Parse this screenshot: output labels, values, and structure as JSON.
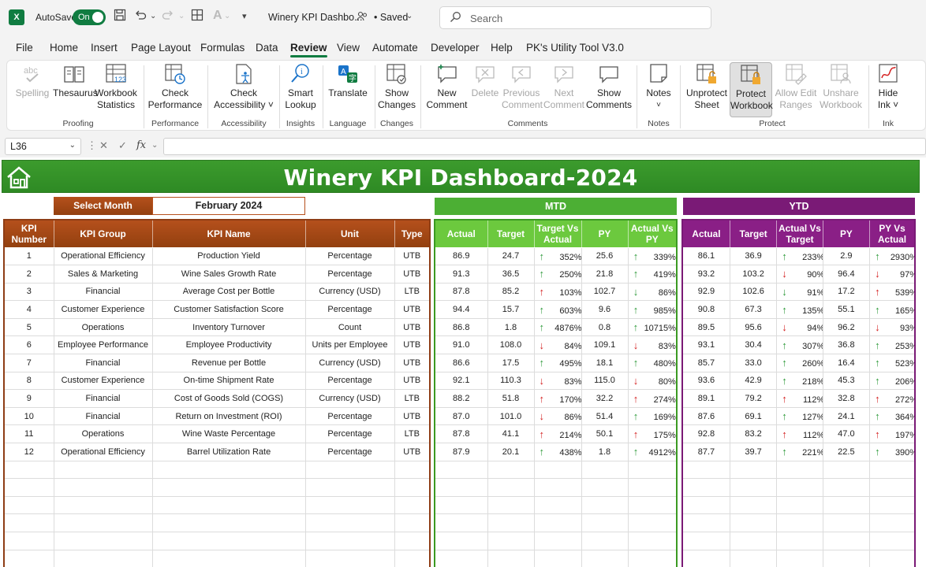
{
  "titlebar": {
    "app_badge": "X",
    "autosave_label": "AutoSave",
    "autosave_state": "On",
    "doc_title": "Winery KPI Dashbo...",
    "saved_status": "• Saved",
    "search_placeholder": "Search"
  },
  "menu": [
    "File",
    "Home",
    "Insert",
    "Page Layout",
    "Formulas",
    "Data",
    "Review",
    "View",
    "Automate",
    "Developer",
    "Help",
    "PK's Utility Tool V3.0"
  ],
  "menu_active": "Review",
  "ribbon": {
    "spelling": "Spelling",
    "thesaurus": "Thesaurus",
    "workbook_statistics_1": "Workbook",
    "workbook_statistics_2": "Statistics",
    "check_performance_1": "Check",
    "check_performance_2": "Performance",
    "check_accessibility_1": "Check",
    "check_accessibility_2": "Accessibility ˅",
    "smart_lookup_1": "Smart",
    "smart_lookup_2": "Lookup",
    "translate": "Translate",
    "show_changes_1": "Show",
    "show_changes_2": "Changes",
    "new_comment_1": "New",
    "new_comment_2": "Comment",
    "delete": "Delete",
    "previous_comment_1": "Previous",
    "previous_comment_2": "Comment",
    "next_comment_1": "Next",
    "next_comment_2": "Comment",
    "show_comments_1": "Show",
    "show_comments_2": "Comments",
    "notes": "Notes",
    "notes_caret": "˅",
    "unprotect_sheet_1": "Unprotect",
    "unprotect_sheet_2": "Sheet",
    "protect_workbook_1": "Protect",
    "protect_workbook_2": "Workbook",
    "allow_edit_ranges_1": "Allow Edit",
    "allow_edit_ranges_2": "Ranges",
    "unshare_workbook_1": "Unshare",
    "unshare_workbook_2": "Workbook",
    "hide_ink_1": "Hide",
    "hide_ink_2": "Ink ˅",
    "groups": {
      "proofing": "Proofing",
      "performance": "Performance",
      "accessibility": "Accessibility",
      "insights": "Insights",
      "language": "Language",
      "changes": "Changes",
      "comments": "Comments",
      "notes": "Notes",
      "protect": "Protect",
      "ink": "Ink"
    }
  },
  "formula_bar": {
    "name_box": "L36",
    "fx": "fx",
    "formula": ""
  },
  "dashboard": {
    "title": "Winery KPI Dashboard-2024",
    "select_month_label": "Select Month",
    "selected_month": "February 2024",
    "mtd_label": "MTD",
    "ytd_label": "YTD",
    "kpi_headers": [
      "KPI Number",
      "KPI Group",
      "KPI Name",
      "Unit",
      "Type"
    ],
    "mtd_headers": [
      "Actual",
      "Target",
      "Target Vs Actual",
      "PY",
      "Actual Vs PY"
    ],
    "ytd_headers": [
      "Actual",
      "Target",
      "Actual Vs Target",
      "PY",
      "PY Vs Actual"
    ],
    "rows": [
      {
        "num": "1",
        "group": "Operational Efficiency",
        "name": "Production Yield",
        "unit": "Percentage",
        "type": "UTB",
        "mtd": {
          "actual": "86.9",
          "target": "24.7",
          "tva_dir": "up",
          "tva": "352%",
          "py": "25.6",
          "avp_dir": "up",
          "avp": "339%"
        },
        "ytd": {
          "actual": "86.1",
          "target": "36.9",
          "avt_dir": "up",
          "avt": "233%",
          "py": "2.9",
          "pva_dir": "up",
          "pva": "2930%"
        }
      },
      {
        "num": "2",
        "group": "Sales & Marketing",
        "name": "Wine Sales Growth Rate",
        "unit": "Percentage",
        "type": "UTB",
        "mtd": {
          "actual": "91.3",
          "target": "36.5",
          "tva_dir": "up",
          "tva": "250%",
          "py": "21.8",
          "avp_dir": "up",
          "avp": "419%"
        },
        "ytd": {
          "actual": "93.2",
          "target": "103.2",
          "avt_dir": "down",
          "avt": "90%",
          "py": "96.4",
          "pva_dir": "down",
          "pva": "97%"
        }
      },
      {
        "num": "3",
        "group": "Financial",
        "name": "Average Cost per Bottle",
        "unit": "Currency (USD)",
        "type": "LTB",
        "mtd": {
          "actual": "87.8",
          "target": "85.2",
          "tva_dir": "up-red",
          "tva": "103%",
          "py": "102.7",
          "avp_dir": "down-green",
          "avp": "86%"
        },
        "ytd": {
          "actual": "92.9",
          "target": "102.6",
          "avt_dir": "down-green",
          "avt": "91%",
          "py": "17.2",
          "pva_dir": "up-red",
          "pva": "539%"
        }
      },
      {
        "num": "4",
        "group": "Customer Experience",
        "name": "Customer Satisfaction Score",
        "unit": "Percentage",
        "type": "UTB",
        "mtd": {
          "actual": "94.4",
          "target": "15.7",
          "tva_dir": "up",
          "tva": "603%",
          "py": "9.6",
          "avp_dir": "up",
          "avp": "985%"
        },
        "ytd": {
          "actual": "90.8",
          "target": "67.3",
          "avt_dir": "up",
          "avt": "135%",
          "py": "55.1",
          "pva_dir": "up",
          "pva": "165%"
        }
      },
      {
        "num": "5",
        "group": "Operations",
        "name": "Inventory Turnover",
        "unit": "Count",
        "type": "UTB",
        "mtd": {
          "actual": "86.8",
          "target": "1.8",
          "tva_dir": "up",
          "tva": "4876%",
          "py": "0.8",
          "avp_dir": "up",
          "avp": "10715%"
        },
        "ytd": {
          "actual": "89.5",
          "target": "95.6",
          "avt_dir": "down",
          "avt": "94%",
          "py": "96.2",
          "pva_dir": "down",
          "pva": "93%"
        }
      },
      {
        "num": "6",
        "group": "Employee Performance",
        "name": "Employee Productivity",
        "unit": "Units per Employee",
        "type": "UTB",
        "mtd": {
          "actual": "91.0",
          "target": "108.0",
          "tva_dir": "down",
          "tva": "84%",
          "py": "109.1",
          "avp_dir": "down",
          "avp": "83%"
        },
        "ytd": {
          "actual": "93.1",
          "target": "30.4",
          "avt_dir": "up",
          "avt": "307%",
          "py": "36.8",
          "pva_dir": "up",
          "pva": "253%"
        }
      },
      {
        "num": "7",
        "group": "Financial",
        "name": "Revenue per Bottle",
        "unit": "Currency (USD)",
        "type": "UTB",
        "mtd": {
          "actual": "86.6",
          "target": "17.5",
          "tva_dir": "up",
          "tva": "495%",
          "py": "18.1",
          "avp_dir": "up",
          "avp": "480%"
        },
        "ytd": {
          "actual": "85.7",
          "target": "33.0",
          "avt_dir": "up",
          "avt": "260%",
          "py": "16.4",
          "pva_dir": "up",
          "pva": "523%"
        }
      },
      {
        "num": "8",
        "group": "Customer Experience",
        "name": "On-time Shipment Rate",
        "unit": "Percentage",
        "type": "UTB",
        "mtd": {
          "actual": "92.1",
          "target": "110.3",
          "tva_dir": "down",
          "tva": "83%",
          "py": "115.0",
          "avp_dir": "down",
          "avp": "80%"
        },
        "ytd": {
          "actual": "93.6",
          "target": "42.9",
          "avt_dir": "up",
          "avt": "218%",
          "py": "45.3",
          "pva_dir": "up",
          "pva": "206%"
        }
      },
      {
        "num": "9",
        "group": "Financial",
        "name": "Cost of Goods Sold (COGS)",
        "unit": "Currency (USD)",
        "type": "LTB",
        "mtd": {
          "actual": "88.2",
          "target": "51.8",
          "tva_dir": "up-red",
          "tva": "170%",
          "py": "32.2",
          "avp_dir": "up-red",
          "avp": "274%"
        },
        "ytd": {
          "actual": "89.1",
          "target": "79.2",
          "avt_dir": "up-red",
          "avt": "112%",
          "py": "32.8",
          "pva_dir": "up-red",
          "pva": "272%"
        }
      },
      {
        "num": "10",
        "group": "Financial",
        "name": "Return on Investment (ROI)",
        "unit": "Percentage",
        "type": "UTB",
        "mtd": {
          "actual": "87.0",
          "target": "101.0",
          "tva_dir": "down",
          "tva": "86%",
          "py": "51.4",
          "avp_dir": "up",
          "avp": "169%"
        },
        "ytd": {
          "actual": "87.6",
          "target": "69.1",
          "avt_dir": "up",
          "avt": "127%",
          "py": "24.1",
          "pva_dir": "up",
          "pva": "364%"
        }
      },
      {
        "num": "11",
        "group": "Operations",
        "name": "Wine Waste Percentage",
        "unit": "Percentage",
        "type": "LTB",
        "mtd": {
          "actual": "87.8",
          "target": "41.1",
          "tva_dir": "up-red",
          "tva": "214%",
          "py": "50.1",
          "avp_dir": "up-red",
          "avp": "175%"
        },
        "ytd": {
          "actual": "92.8",
          "target": "83.2",
          "avt_dir": "up-red",
          "avt": "112%",
          "py": "47.0",
          "pva_dir": "up-red",
          "pva": "197%"
        }
      },
      {
        "num": "12",
        "group": "Operational Efficiency",
        "name": "Barrel Utilization Rate",
        "unit": "Percentage",
        "type": "UTB",
        "mtd": {
          "actual": "87.9",
          "target": "20.1",
          "tva_dir": "up",
          "tva": "438%",
          "py": "1.8",
          "avp_dir": "up",
          "avp": "4912%"
        },
        "ytd": {
          "actual": "87.7",
          "target": "39.7",
          "avt_dir": "up",
          "avt": "221%",
          "py": "22.5",
          "pva_dir": "up",
          "pva": "390%"
        }
      }
    ],
    "empty_rows": 6
  },
  "colors": {
    "excel_green": "#107c41",
    "banner_green": "#3c9b2d",
    "kpi_brown": "#a64a17",
    "mtd_green": "#6cc93e",
    "ytd_purple": "#8a1f86",
    "arrow_up": "#2e9a3a",
    "arrow_down": "#d42020"
  }
}
